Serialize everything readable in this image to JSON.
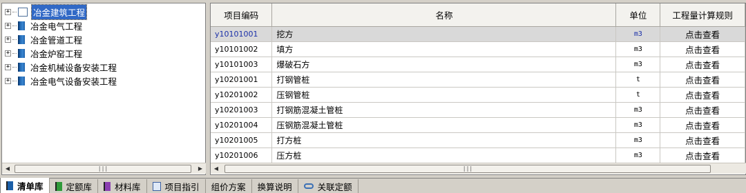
{
  "tree": {
    "items": [
      {
        "label": "冶金建筑工程",
        "selected": true,
        "icon": "open-book-icon"
      },
      {
        "label": "冶金电气工程",
        "selected": false,
        "icon": "book-icon"
      },
      {
        "label": "冶金管道工程",
        "selected": false,
        "icon": "book-icon"
      },
      {
        "label": "冶金炉窑工程",
        "selected": false,
        "icon": "book-icon"
      },
      {
        "label": "冶金机械设备安装工程",
        "selected": false,
        "icon": "book-icon"
      },
      {
        "label": "冶金电气设备安装工程",
        "selected": false,
        "icon": "book-icon"
      }
    ]
  },
  "grid": {
    "columns": [
      "项目编码",
      "名称",
      "单位",
      "工程量计算规则"
    ],
    "rows": [
      {
        "code": "y10101001",
        "name": "挖方",
        "unit": "m3",
        "rule": "点击查看"
      },
      {
        "code": "y10101002",
        "name": "填方",
        "unit": "m3",
        "rule": "点击查看"
      },
      {
        "code": "y10101003",
        "name": "爆破石方",
        "unit": "m3",
        "rule": "点击查看"
      },
      {
        "code": "y10201001",
        "name": "打钢管桩",
        "unit": "t",
        "rule": "点击查看"
      },
      {
        "code": "y10201002",
        "name": "压钢管桩",
        "unit": "t",
        "rule": "点击查看"
      },
      {
        "code": "y10201003",
        "name": "打钢筋混凝土管桩",
        "unit": "m3",
        "rule": "点击查看"
      },
      {
        "code": "y10201004",
        "name": "压钢筋混凝土管桩",
        "unit": "m3",
        "rule": "点击查看"
      },
      {
        "code": "y10201005",
        "name": "打方桩",
        "unit": "m3",
        "rule": "点击查看"
      },
      {
        "code": "y10201006",
        "name": "压方桩",
        "unit": "m3",
        "rule": "点击查看"
      }
    ],
    "selected_row": 0
  },
  "tabs": [
    {
      "label": "清单库",
      "icon": "blue-book-icon",
      "active": true
    },
    {
      "label": "定额库",
      "icon": "green-book-icon",
      "active": false
    },
    {
      "label": "材料库",
      "icon": "purple-book-icon",
      "active": false
    },
    {
      "label": "项目指引",
      "icon": "guide-icon",
      "active": false
    },
    {
      "label": "组价方案",
      "icon": "",
      "active": false
    },
    {
      "label": "换算说明",
      "icon": "",
      "active": false
    },
    {
      "label": "关联定额",
      "icon": "link-icon",
      "active": false
    }
  ],
  "colors": {
    "selection_bg": "#3169c6",
    "selected_row_text": "#1a2fa8",
    "tab_icon_blue": "#1b5fa8",
    "tab_icon_green": "#2f9a3a",
    "tab_icon_purple": "#8a3fb0"
  }
}
